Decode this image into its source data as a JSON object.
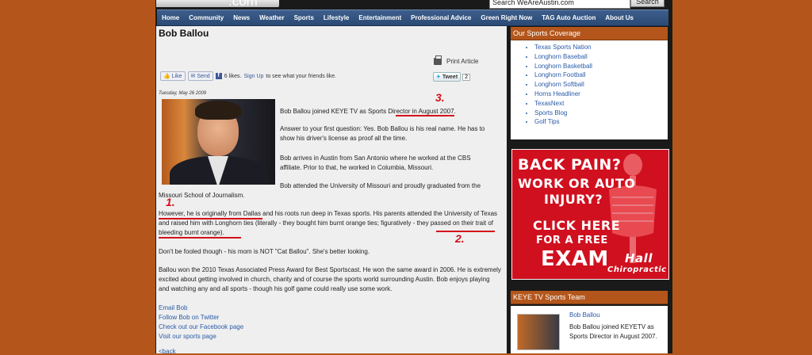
{
  "site": {
    "logo_text": ".com",
    "search_placeholder": "Search WeAreAustin.com",
    "search_button": "Search"
  },
  "nav": [
    "Home",
    "Community",
    "News",
    "Weather",
    "Sports",
    "Lifestyle",
    "Entertainment",
    "Professional Advice",
    "Green Right Now",
    "TAG Auto Auction",
    "About Us"
  ],
  "article": {
    "title": "Bob Ballou",
    "print_label": "Print Article",
    "fb_like": "Like",
    "fb_send": "Send",
    "fb_text_pre": "6 likes.",
    "fb_signup": "Sign Up",
    "fb_text_post": "to see what your friends like.",
    "tweet_label": "Tweet",
    "tweet_count": "2",
    "date": "Tuesday, May 26 2009",
    "p1_pre": "Bob Ballou joined KEYE TV as Sports Director in ",
    "p1_link": "August 2007",
    "p1_post": ".",
    "p2": "Answer to your first question: Yes. Bob Ballou is his real name. He has to show his driver's license as proof all the time.",
    "p3": "Bob arrives in Austin from San Antonio where he worked at the CBS affiliate. Prior to that, he worked in Columbia, Missouri.",
    "p4a": "Bob attended the University of Missouri and proudly graduated from the",
    "p4b": "Missouri School of Journalism.",
    "p5": "However, he is originally from Dallas and his roots run deep in Texas sports. His parents attended the University of Texas and raised him with Longhorn ties (literally - they bought him burnt orange ties; figuratively - they passed on their trait of bleeding burnt orange).",
    "p6": "Don't be fooled though - his mom is NOT \"Cat Ballou\". She's better looking.",
    "p7": "Ballou won the 2010 Texas Associated Press Award for Best Sportscast.  He won the same award in 2006.  He is extremely excited about getting involved in church, charity and of course the sports world surrounding Austin. Bob enjoys playing and watching any and all sports - though his golf game could really use some work.",
    "links": [
      "Email Bob",
      "Follow Bob on Twitter",
      "Check out our Facebook page",
      "Visit our sports page"
    ],
    "back": "<back"
  },
  "annotations": [
    "1.",
    "2.",
    "3."
  ],
  "sidebar": {
    "coverage_title": "Our Sports Coverage",
    "coverage_items": [
      "Texas Sports Nation",
      "Longhorn Baseball",
      "Longhorn Basketball",
      "Longhorn Football",
      "Longhorn Softball",
      "Horns Headliner",
      "TexasNext",
      "Sports Blog",
      "Golf Tips"
    ],
    "ad_lines": [
      "BACK PAIN?",
      "WORK OR AUTO",
      "INJURY?",
      "CLICK HERE",
      "FOR A FREE",
      "EXAM"
    ],
    "ad_brand": "Hall",
    "ad_brand_sub": "Chiropractic",
    "team_title": "KEYE TV Sports Team",
    "team_name": "Bob Ballou",
    "team_desc": "Bob Ballou joined KEYETV as Sports Director in August 2007."
  },
  "colors": {
    "accent": "#b4561b",
    "nav": "#2b4a75",
    "annotation": "#d4111a",
    "link": "#2a5ba8"
  }
}
